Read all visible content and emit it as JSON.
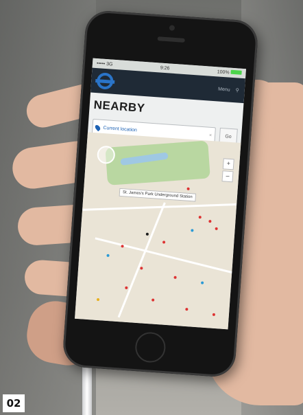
{
  "photo": {
    "subject": "hand holding smartphone showing map app",
    "figure_label": "02"
  },
  "app": {
    "status_bar": {
      "carrier": "••••• 3G",
      "time": "9:26",
      "battery": "100%"
    },
    "header": {
      "logo": "roundel-logo",
      "menu_label": "Menu",
      "search_icon": "search-icon"
    },
    "page_title": "NEARBY",
    "location_input": {
      "value": "Current location",
      "placeholder": ""
    },
    "go_button": "Go",
    "map": {
      "station_label": "St. James's Park Underground Station",
      "zoom_in": "+",
      "zoom_out": "–"
    }
  },
  "colors": {
    "header_bg": "#1f2a36",
    "roundel_blue": "#2a74c8",
    "link_blue": "#1d62b4",
    "park_green": "#b9d7a1",
    "map_bg": "#eae4d6"
  }
}
